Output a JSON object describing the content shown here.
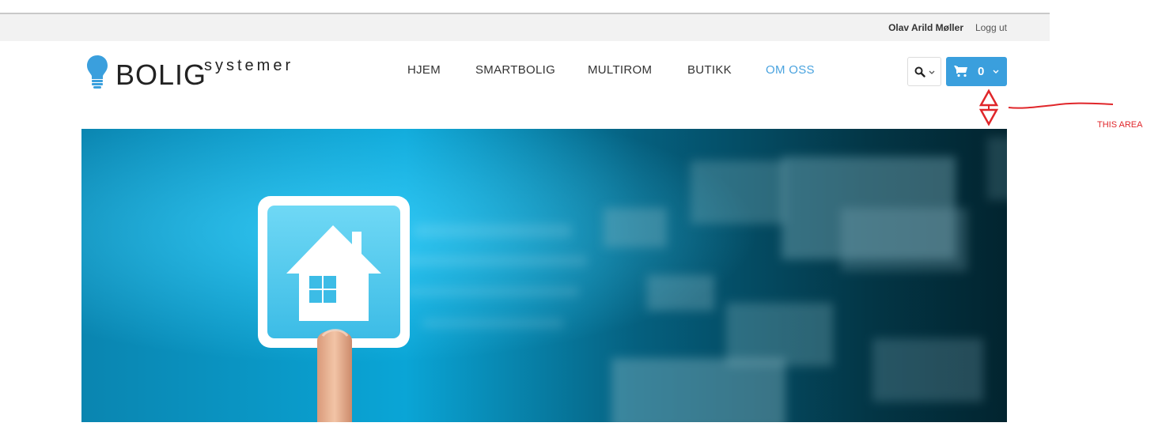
{
  "top_bar": {
    "user_name": "Olav Arild Møller",
    "logout_label": "Logg ut"
  },
  "logo": {
    "main": "BOLIG",
    "sub": "systemer"
  },
  "nav": {
    "items": [
      {
        "label": "HJEM"
      },
      {
        "label": "SMARTBOLIG"
      },
      {
        "label": "MULTIROM"
      },
      {
        "label": "BUTIKK"
      },
      {
        "label": "OM OSS",
        "active": true
      }
    ]
  },
  "cart": {
    "count": "0"
  },
  "annotation": {
    "label": "THIS AREA"
  },
  "colors": {
    "accent": "#3a9fdd",
    "active_nav": "#4aa3df",
    "annotation": "#e0262a"
  }
}
